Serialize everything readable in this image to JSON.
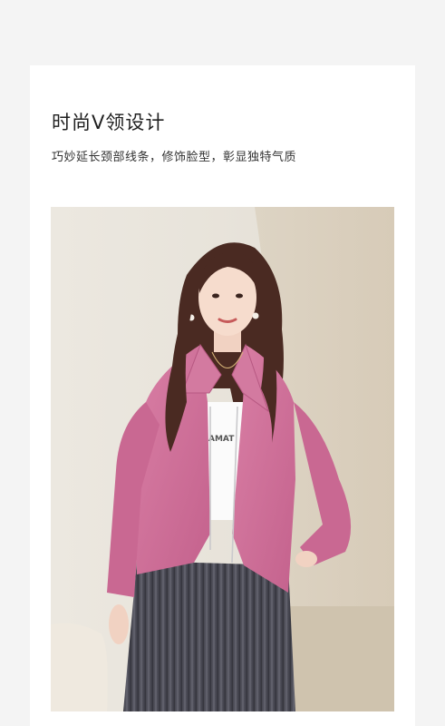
{
  "section": {
    "title": "时尚V领设计",
    "subtitle": "巧妙延长颈部线条，修饰脸型，彰显独特气质"
  },
  "product_photo": {
    "shirt_print_text": "AMAT"
  },
  "colors": {
    "page_background": "#f4f4f4",
    "card_background": "#ffffff",
    "jacket": "#cf6f98",
    "skirt": "#4b4b55",
    "wall": "#e6e1d8"
  }
}
